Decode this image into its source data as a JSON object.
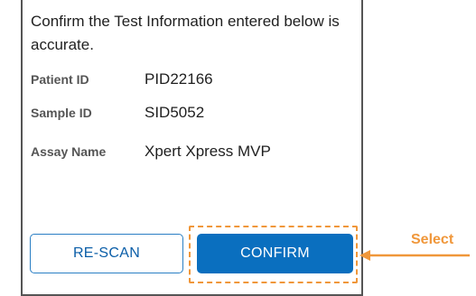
{
  "dialog": {
    "instruction": "Confirm the Test Information entered below is accurate.",
    "fields": [
      {
        "label": "Patient ID",
        "value": "PID22166"
      },
      {
        "label": "Sample ID",
        "value": "SID5052"
      },
      {
        "label": "Assay Name",
        "value": "Xpert Xpress MVP"
      }
    ],
    "buttons": {
      "rescan_label": "RE-SCAN",
      "confirm_label": "CONFIRM"
    }
  },
  "annotation": {
    "label": "Select",
    "color": "#f0973a"
  },
  "colors": {
    "primary": "#0a6fbf",
    "outline_button": "#2a7fc4",
    "panel_border": "#555555"
  }
}
